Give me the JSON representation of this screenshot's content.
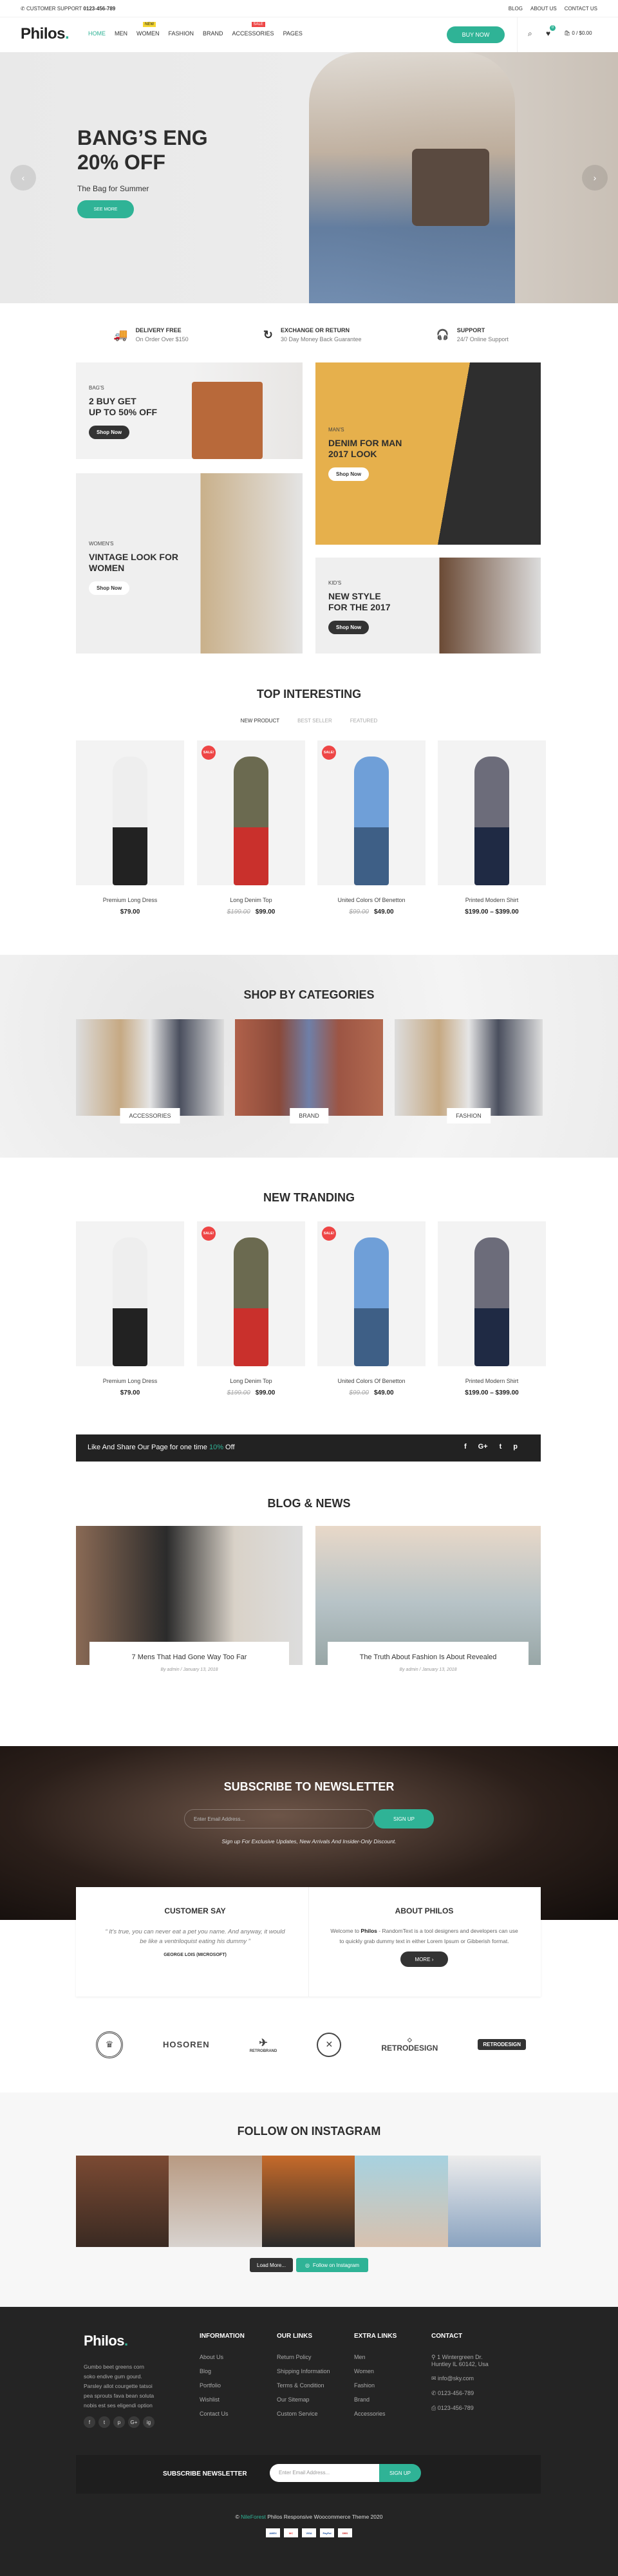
{
  "topbar": {
    "support_label": "CUSTOMER SUPPORT",
    "support_phone": "0123-456-789",
    "links": [
      "BLOG",
      "ABOUT US",
      "CONTACT US"
    ]
  },
  "header": {
    "logo": "Philos",
    "logo_dot": ".",
    "nav": [
      {
        "label": "HOME",
        "active": true
      },
      {
        "label": "MEN"
      },
      {
        "label": "WOMEN",
        "badge": "NEW"
      },
      {
        "label": "FASHION"
      },
      {
        "label": "BRAND"
      },
      {
        "label": "ACCESSORIES",
        "badge": "SALE"
      },
      {
        "label": "PAGES"
      }
    ],
    "buy_now": "BUY NOW",
    "wishlist_count": "0",
    "cart": "0 / $0.00"
  },
  "colors": {
    "accent": "#2fb396",
    "dark": "#222222",
    "sale": "#ee4545",
    "new_badge": "#f5d631"
  },
  "hero": {
    "title_line1": "BANG’S ENG",
    "title_line2": "20% OFF",
    "subtitle": "The Bag for Summer",
    "button": "SEE MORE"
  },
  "features": [
    {
      "icon": "truck-icon",
      "title": "DELIVERY FREE",
      "subtitle": "On Order Over $150"
    },
    {
      "icon": "refresh-icon",
      "title": "EXCHANGE OR RETURN",
      "subtitle": "30 Day Money Back Guarantee"
    },
    {
      "icon": "headphones-icon",
      "title": "SUPPORT",
      "subtitle": "24/7 Online Support"
    }
  ],
  "banners": {
    "bags": {
      "category": "BAG'S",
      "title_line1": "2 BUY GET",
      "title_line2": "UP TO 50% OFF",
      "button": "Shop Now"
    },
    "men": {
      "category": "MAN'S",
      "title_line1": "DENIM FOR MAN",
      "title_line2": "2017 LOOK",
      "button": "Shop Now"
    },
    "women": {
      "category": "WOMEN'S",
      "title_line1": "VINTAGE LOOK FOR",
      "title_line2": "WOMEN",
      "button": "Shop Now"
    },
    "kids": {
      "category": "KID'S",
      "title_line1": "NEW STYLE",
      "title_line2": "FOR THE 2017",
      "button": "Shop Now"
    }
  },
  "top_interesting": {
    "title": "TOP INTERESTING",
    "tabs": [
      "NEW PRODUCT",
      "BEST SELLER",
      "FEATURED"
    ],
    "active_tab": 0
  },
  "products": [
    {
      "name": "Premium Long Dress",
      "price": "$79.00",
      "old_price": "",
      "sale": false
    },
    {
      "name": "Long Denim Top",
      "price": "$99.00",
      "old_price": "$199.00",
      "sale": true
    },
    {
      "name": "United Colors Of Benetton",
      "price": "$49.00",
      "old_price": "$99.00",
      "sale": true
    },
    {
      "name": "Printed Modern Shirt",
      "price": "$199.00 – $399.00",
      "old_price": "",
      "sale": false
    }
  ],
  "sale_badge": "SALE!",
  "categories": {
    "title": "SHOP BY CATEGORIES",
    "items": [
      "ACCESSORIES",
      "BRAND",
      "FASHION"
    ]
  },
  "new_trending": {
    "title": "NEW TRANDING"
  },
  "share_bar": {
    "text_before": "Like And Share Our Page for one time ",
    "highlight": "10%",
    "text_after": " Off",
    "icons": [
      "f",
      "G+",
      "t",
      "p"
    ]
  },
  "blog": {
    "title": "BLOG & NEWS",
    "posts": [
      {
        "title": "7 Mens That Had Gone Way Too Far",
        "meta": "By admin / January 13, 2018"
      },
      {
        "title": "The Truth About Fashion Is About Revealed",
        "meta": "By admin / January 13, 2018"
      }
    ]
  },
  "newsletter": {
    "title": "SUBSCRIBE TO NEWSLETTER",
    "placeholder": "Enter Email Address...",
    "button": "SIGN UP",
    "note": "Sign up For Exclusive Updates, New Arrivals And Insider-Only Discount."
  },
  "customer_say": {
    "title": "CUSTOMER SAY",
    "quote": "It's true, you can never eat a pet you name. And anyway, it would be like a ventriloquist eating his dummy",
    "author": "GEORGE LOIS (MICROSOFT)"
  },
  "about": {
    "title": "ABOUT PHILOS",
    "text_before": "Welcome to ",
    "brand": "Philos",
    "text_after": " - RandomText is a tool designers and developers can use to quickly grab dummy text in either Lorem Ipsum or Gibberish format.",
    "button": "MORE ›"
  },
  "brand_logos": [
    "crown-badge",
    "HOSOREN",
    "RETROBRAND",
    "crossed-arrows-badge",
    "RETRODESIGN",
    "RETRODESIGN"
  ],
  "instagram": {
    "title": "FOLLOW ON INSTAGRAM",
    "load_more": "Load More...",
    "follow": "Follow on Instagram"
  },
  "footer": {
    "logo": "Philos",
    "about": "Gumbo beet greens corn soko endive gum gourd. Parsley allot courgette tatsoi pea sprouts fava bean soluta nobis est ses eligendi option",
    "social": [
      "f",
      "t",
      "p",
      "G+",
      "ig"
    ],
    "columns": [
      {
        "title": "INFORMATION",
        "links": [
          "About Us",
          "Blog",
          "Portfolio",
          "Wishlist",
          "Contact Us"
        ]
      },
      {
        "title": "OUR LINKS",
        "links": [
          "Return Policy",
          "Shipping Information",
          "Terms & Condition",
          "Our Sitemap",
          "Custom Service"
        ]
      },
      {
        "title": "EXTRA LINKS",
        "links": [
          "Men",
          "Women",
          "Fashion",
          "Brand",
          "Accessories"
        ]
      }
    ],
    "contact": {
      "title": "CONTACT",
      "address": "1 Wintergreen Dr. Huntley IL 60142, Usa",
      "email": "info@sky.com",
      "phone": "0123-456-789",
      "fax": "0123-456-789"
    },
    "subscribe": {
      "title": "SUBSCRIBE NEWSLETTER",
      "placeholder": "Enter Email Address...",
      "button": "SIGN UP"
    },
    "copyright_prefix": "© ",
    "copyright_link": "NileForest",
    "copyright_text": " Philos Responsive Woocommerce Theme 2020",
    "payments": [
      "AMEX",
      "MC",
      "VISA",
      "PayPal",
      "DBS"
    ]
  }
}
